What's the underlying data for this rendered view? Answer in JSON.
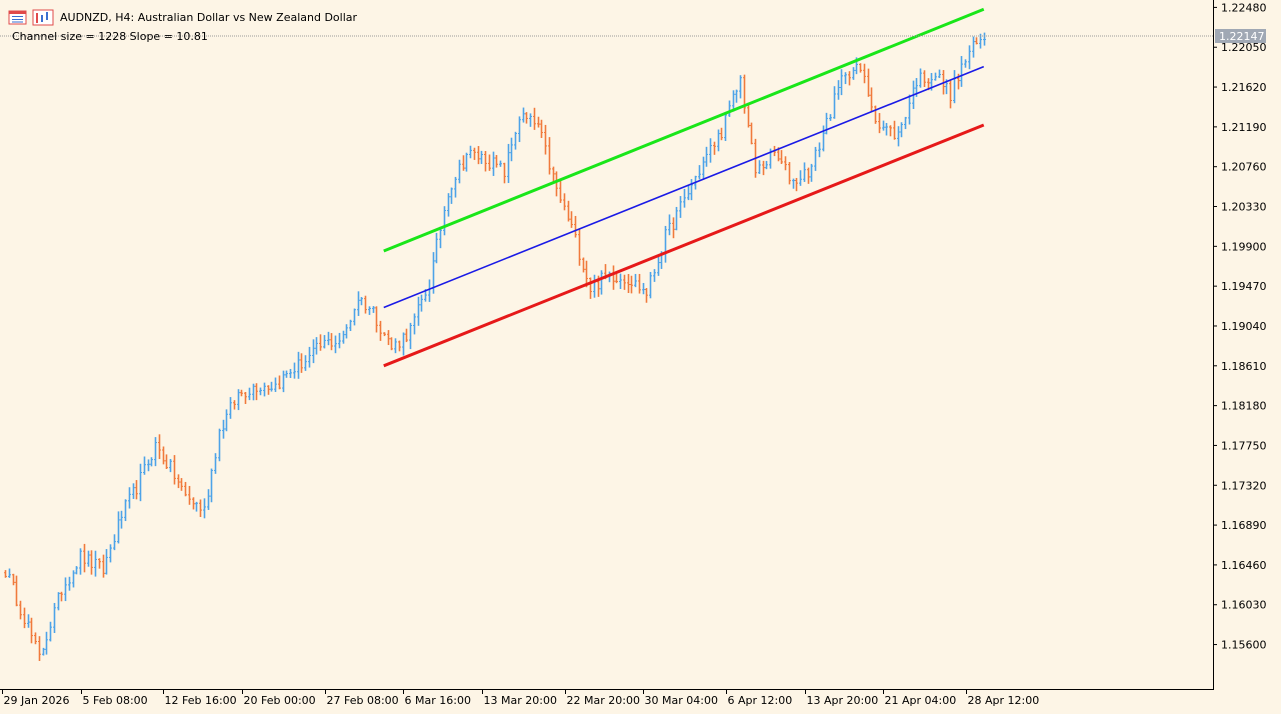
{
  "header": {
    "symbol_line": "AUDNZD, H4:  Australian Dollar vs New Zealand Dollar",
    "info_line": "Channel size = 1228 Slope = 10.81"
  },
  "colors": {
    "background": "#fdf5e6",
    "bull": "#4da3e8",
    "bear": "#f07a3c",
    "upper_line": "#19e619",
    "middle_line": "#1a1ae6",
    "lower_line": "#e61919",
    "price_label_bg": "#a0a8b4"
  },
  "chart_data": {
    "type": "ohlc",
    "symbol": "AUDNZD",
    "timeframe": "H4",
    "ylim": [
      1.1512,
      1.2256
    ],
    "y_ticks": [
      "1.22480",
      "1.22050",
      "1.21620",
      "1.21190",
      "1.20760",
      "1.20330",
      "1.19900",
      "1.19470",
      "1.19040",
      "1.18610",
      "1.18180",
      "1.17750",
      "1.17320",
      "1.16890",
      "1.16460",
      "1.16030",
      "1.15600"
    ],
    "x_ticks": [
      "29 Jan 2026",
      "5 Feb 08:00",
      "12 Feb 16:00",
      "20 Feb 00:00",
      "27 Feb 08:00",
      "6 Mar 16:00",
      "13 Mar 20:00",
      "22 Mar 20:00",
      "30 Mar 04:00",
      "6 Apr 12:00",
      "13 Apr 20:00",
      "21 Apr 04:00",
      "28 Apr 12:00"
    ],
    "current_price": "1.22147",
    "channel_size": 1228,
    "slope": 10.81,
    "close_path": [
      {
        "bar": 0,
        "close": 1.164
      },
      {
        "bar": 6,
        "close": 1.158
      },
      {
        "bar": 9,
        "close": 1.1545
      },
      {
        "bar": 15,
        "close": 1.162
      },
      {
        "bar": 20,
        "close": 1.1655
      },
      {
        "bar": 26,
        "close": 1.164
      },
      {
        "bar": 31,
        "close": 1.17
      },
      {
        "bar": 35,
        "close": 1.173
      },
      {
        "bar": 40,
        "close": 1.1775
      },
      {
        "bar": 44,
        "close": 1.175
      },
      {
        "bar": 48,
        "close": 1.172
      },
      {
        "bar": 53,
        "close": 1.1705
      },
      {
        "bar": 57,
        "close": 1.179
      },
      {
        "bar": 62,
        "close": 1.183
      },
      {
        "bar": 67,
        "close": 1.184
      },
      {
        "bar": 72,
        "close": 1.184
      },
      {
        "bar": 76,
        "close": 1.1855
      },
      {
        "bar": 81,
        "close": 1.187
      },
      {
        "bar": 85,
        "close": 1.1885
      },
      {
        "bar": 90,
        "close": 1.189
      },
      {
        "bar": 94,
        "close": 1.1935
      },
      {
        "bar": 98,
        "close": 1.192
      },
      {
        "bar": 103,
        "close": 1.188
      },
      {
        "bar": 108,
        "close": 1.19
      },
      {
        "bar": 113,
        "close": 1.195
      },
      {
        "bar": 118,
        "close": 1.205
      },
      {
        "bar": 123,
        "close": 1.209
      },
      {
        "bar": 128,
        "close": 1.2085
      },
      {
        "bar": 133,
        "close": 1.207
      },
      {
        "bar": 137,
        "close": 1.213
      },
      {
        "bar": 142,
        "close": 1.212
      },
      {
        "bar": 147,
        "close": 1.205
      },
      {
        "bar": 151,
        "close": 1.201
      },
      {
        "bar": 156,
        "close": 1.1945
      },
      {
        "bar": 161,
        "close": 1.196
      },
      {
        "bar": 166,
        "close": 1.1955
      },
      {
        "bar": 171,
        "close": 1.194
      },
      {
        "bar": 176,
        "close": 1.2
      },
      {
        "bar": 181,
        "close": 1.204
      },
      {
        "bar": 186,
        "close": 1.208
      },
      {
        "bar": 191,
        "close": 1.2115
      },
      {
        "bar": 196,
        "close": 1.217
      },
      {
        "bar": 200,
        "close": 1.207
      },
      {
        "bar": 205,
        "close": 1.209
      },
      {
        "bar": 210,
        "close": 1.206
      },
      {
        "bar": 215,
        "close": 1.2075
      },
      {
        "bar": 219,
        "close": 1.2125
      },
      {
        "bar": 224,
        "close": 1.218
      },
      {
        "bar": 228,
        "close": 1.218
      },
      {
        "bar": 233,
        "close": 1.212
      },
      {
        "bar": 238,
        "close": 1.211
      },
      {
        "bar": 243,
        "close": 1.217
      },
      {
        "bar": 248,
        "close": 1.2175
      },
      {
        "bar": 252,
        "close": 1.2155
      },
      {
        "bar": 257,
        "close": 1.22
      },
      {
        "bar": 261,
        "close": 1.2215
      }
    ],
    "channel": {
      "start_bar": 101,
      "end_bar": 261,
      "upper": {
        "start": 1.1985,
        "end": 1.2246
      },
      "middle": {
        "start": 1.1924,
        "end": 1.2184
      },
      "lower": {
        "start": 1.1861,
        "end": 1.2121
      }
    }
  }
}
